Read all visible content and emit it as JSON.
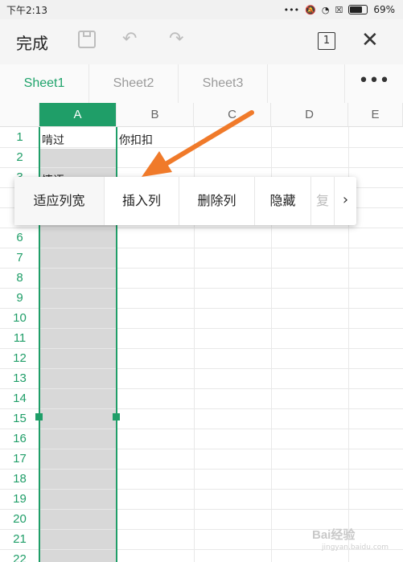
{
  "status_bar": {
    "time": "下午2:13",
    "battery": "69%"
  },
  "toolbar": {
    "done_label": "完成",
    "page_count": "1"
  },
  "sheet_tabs": [
    {
      "label": "Sheet1",
      "active": true
    },
    {
      "label": "Sheet2",
      "active": false
    },
    {
      "label": "Sheet3",
      "active": false
    }
  ],
  "grid": {
    "columns": [
      "A",
      "B",
      "C",
      "D",
      "E"
    ],
    "rows": [
      "1",
      "2",
      "3",
      "4",
      "5",
      "6",
      "7",
      "8",
      "9",
      "10",
      "11",
      "12",
      "13",
      "14",
      "15",
      "16",
      "17",
      "18",
      "19",
      "20",
      "21",
      "22"
    ],
    "selected_column": "A",
    "cells": {
      "A1": "啃过",
      "B1": "你扣扣",
      "A3": "情语"
    }
  },
  "context_menu": {
    "items": [
      "适应列宽",
      "插入列",
      "删除列",
      "隐藏"
    ],
    "partial_item": "复制",
    "next_icon": "chevron-right-icon"
  },
  "watermark": {
    "text": "Bai经验",
    "sub": "jingyan.baidu.com"
  },
  "colors": {
    "accent": "#1f9e68",
    "arrow": "#f07a2a"
  }
}
